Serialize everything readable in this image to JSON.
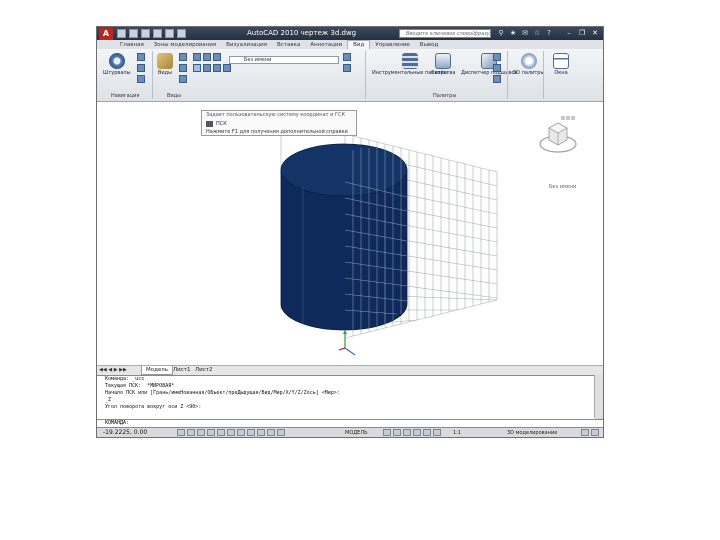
{
  "app": {
    "title": "AutoCAD 2010   чертеж 3d.dwg",
    "search_placeholder": "Введите ключевое слово/фразу",
    "logo_letter": "A"
  },
  "ribbon_tabs": [
    {
      "label": "Главная"
    },
    {
      "label": "Зоны моделирования"
    },
    {
      "label": "Визуализация"
    },
    {
      "label": "Вставка"
    },
    {
      "label": "Аннотации"
    },
    {
      "label": "Вид"
    },
    {
      "label": "Управление"
    },
    {
      "label": "Вывод"
    }
  ],
  "ribbon": {
    "navigate_label": "Штурвалы",
    "views_label": "Виды",
    "named_view_value": "Без имени",
    "tool_palettes_label": "Инструментальные палитры",
    "properties_label": "Свойства",
    "sheet_set_label": "Диспетчер подшивок",
    "cube_3d_label": "3D палитры",
    "windows_label": "Окна",
    "panel_navigation": "Навигация",
    "panel_views": "Виды",
    "panel_palettes": "Палитры"
  },
  "tooltip": {
    "line1": "Задает пользовательскую систему координат и ГСК",
    "ucs_label": "ПСК",
    "line3": "Нажмите F1 для получения дополнительной справки"
  },
  "viewcube": {
    "label": "Без имени"
  },
  "layout_tabs": {
    "model": "Модель",
    "layout1": "Лист1",
    "layout2": "Лист2"
  },
  "command_history": [
    "Команда: _ucs",
    "Текущая ПСК:  *МИРОВАЯ*",
    "Начало ПСК или [Грань/имеНованная/ОБъект/преДыдущая/Вид/Мир/X/Y/Z/Zось] <Мир>:",
    "_Z",
    "Угол поворота вокруг оси Z <90>:"
  ],
  "command_input": "КОМАНДА:",
  "status": {
    "coordinates": "-19.2225, 0.00",
    "model_label": "МОДЕЛЬ",
    "scale": "1:1",
    "workspace": "3D моделирование"
  },
  "colors": {
    "cylinder_fill": "#0e2a5a",
    "cylinder_top": "#143468",
    "wire": "#9aa0a8",
    "title_bar": "#2c3848"
  }
}
